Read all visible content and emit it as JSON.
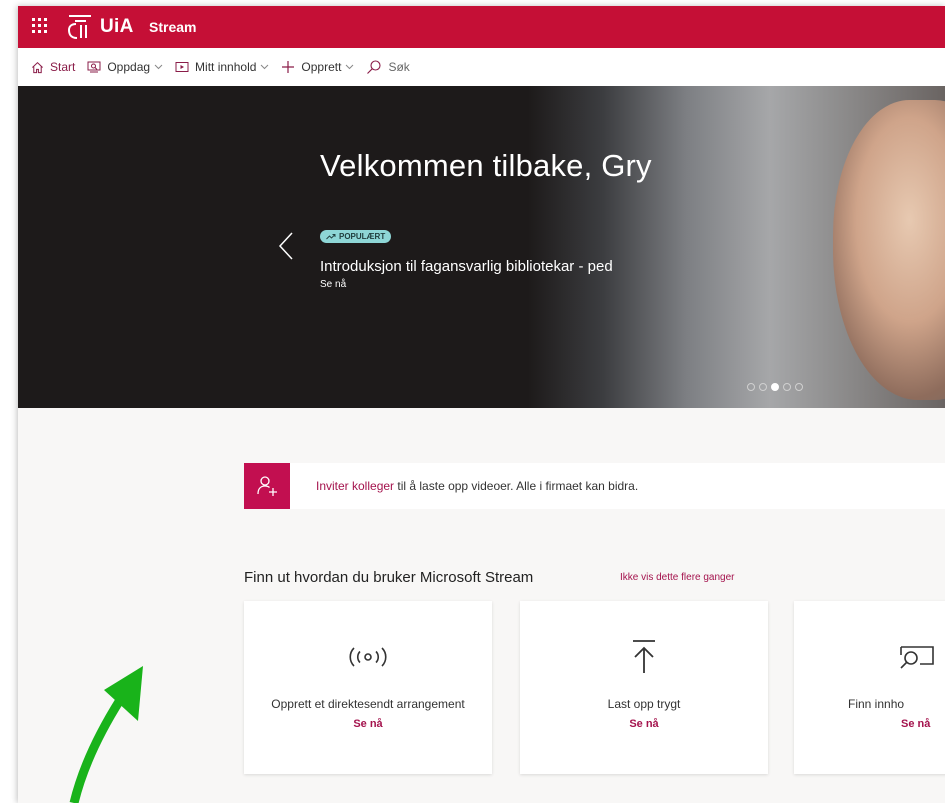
{
  "topbar": {
    "logo_text": "UiA",
    "app_name": "Stream",
    "brand_color": "#c50f36"
  },
  "nav": {
    "start": "Start",
    "discover": "Oppdag",
    "my_content": "Mitt innhold",
    "create": "Opprett",
    "search": "Søk"
  },
  "hero": {
    "title": "Velkommen tilbake, Gry",
    "badge": "POPULÆRT",
    "video_title": "Introduksjon til fagansvarlig bibliotekar - ped",
    "watch_label": "Se nå",
    "slide_count": 5,
    "active_slide": 3
  },
  "invite": {
    "link_text": "Inviter kolleger",
    "rest_text": " til å laste opp videoer. Alle i firmaet kan bidra."
  },
  "learn": {
    "heading": "Finn ut hvordan du bruker Microsoft Stream",
    "dismiss": "Ikke vis dette flere ganger",
    "cards": [
      {
        "title": "Opprett et direktesendt arrangement",
        "link": "Se nå",
        "icon": "broadcast-icon"
      },
      {
        "title": "Last opp trygt",
        "link": "Se nå",
        "icon": "upload-icon"
      },
      {
        "title": "Finn innho",
        "link": "Se nå",
        "icon": "discover-icon"
      }
    ]
  },
  "colors": {
    "accent": "#a4134d",
    "invite_icon_bg": "#c20f50",
    "badge_bg": "#8ed6d6",
    "annotation_arrow": "#19b31a"
  }
}
